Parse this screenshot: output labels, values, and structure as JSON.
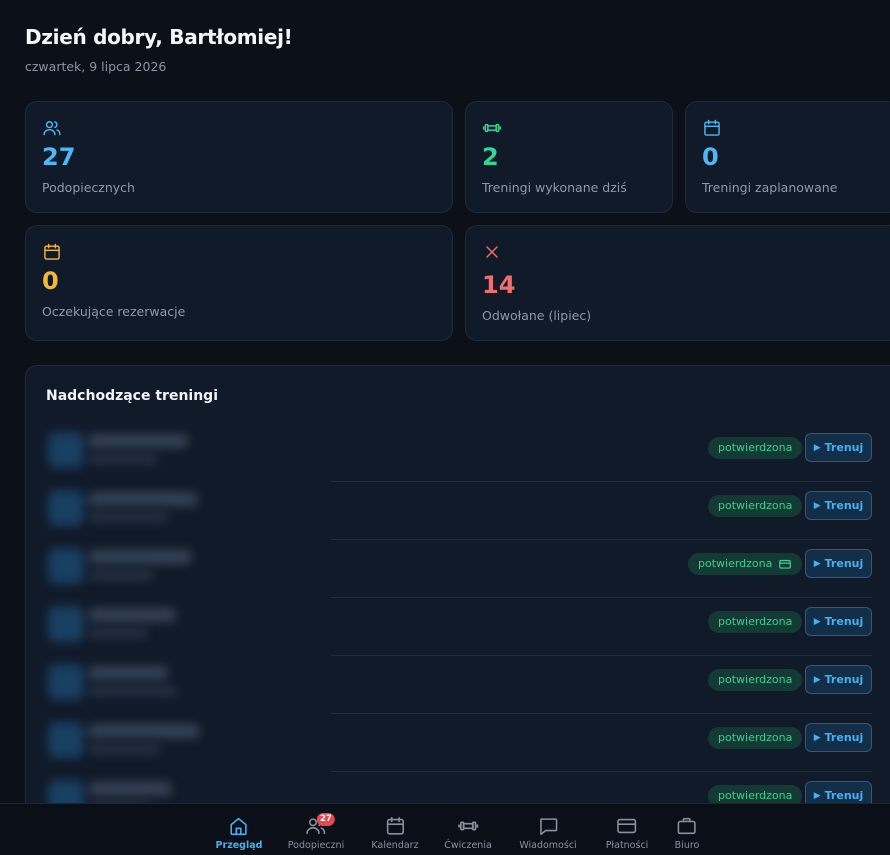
{
  "header": {
    "greeting": "Dzień dobry, Bartłomiej!",
    "date": "czwartek, 9 lipca 2026"
  },
  "stats": [
    {
      "icon": "users-icon",
      "value": "27",
      "label": "Podopiecznych",
      "color": "#4db8f5"
    },
    {
      "icon": "dumbbell-icon",
      "value": "2",
      "label": "Treningi wykonane dziś",
      "color": "#34d399"
    },
    {
      "icon": "calendar-icon",
      "value": "0",
      "label": "Treningi zaplanowane",
      "color": "#4db8f5"
    },
    {
      "icon": "calendar-icon",
      "value": "0",
      "label": "Oczekujące rezerwacje",
      "color": "#f5b935"
    },
    {
      "icon": "x-icon",
      "value": "14",
      "label": "Odwołane (lipiec)",
      "color": "#f26d6d"
    }
  ],
  "upcoming": {
    "title": "Nadchodzące treningi",
    "rows": [
      {
        "status": "potwierdzona",
        "payment_icon": false,
        "action": "Trenuj"
      },
      {
        "status": "potwierdzona",
        "payment_icon": false,
        "action": "Trenuj"
      },
      {
        "status": "potwierdzona",
        "payment_icon": true,
        "action": "Trenuj"
      },
      {
        "status": "potwierdzona",
        "payment_icon": false,
        "action": "Trenuj"
      },
      {
        "status": "potwierdzona",
        "payment_icon": false,
        "action": "Trenuj"
      },
      {
        "status": "potwierdzona",
        "payment_icon": false,
        "action": "Trenuj"
      },
      {
        "status": "potwierdzona",
        "payment_icon": false,
        "action": "Trenuj"
      }
    ]
  },
  "nav": {
    "items": [
      {
        "label": "Przegląd",
        "icon": "home-icon",
        "active": true
      },
      {
        "label": "Podopieczni",
        "icon": "users-icon",
        "badge": "27"
      },
      {
        "label": "Kalendarz",
        "icon": "calendar-icon"
      },
      {
        "label": "Ćwiczenia",
        "icon": "dumbbell-icon"
      },
      {
        "label": "Wiadomości",
        "icon": "message-icon"
      },
      {
        "label": "Płatności",
        "icon": "credit-card-icon"
      },
      {
        "label": "Biuro",
        "icon": "briefcase-icon"
      }
    ]
  },
  "colors": {
    "accent": "#45b1f0",
    "success": "#3ccf95",
    "warning": "#f5b935",
    "danger": "#f26d6d"
  }
}
